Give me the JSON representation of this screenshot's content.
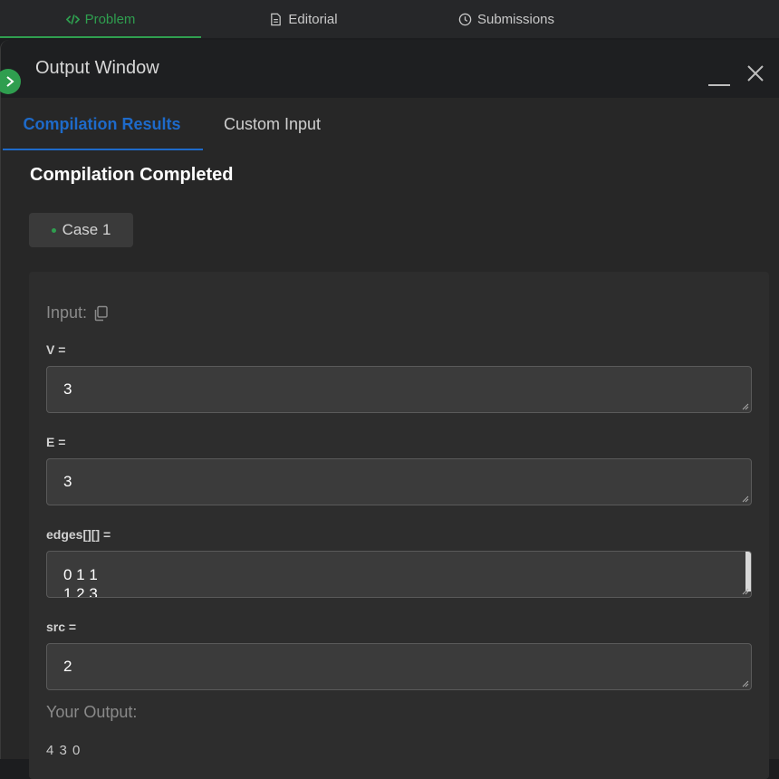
{
  "top_tabs": [
    {
      "label": "Problem",
      "icon": "code-icon",
      "active": true
    },
    {
      "label": "Editorial",
      "icon": "document-icon",
      "active": false
    },
    {
      "label": "Submissions",
      "icon": "clock-icon",
      "active": false
    }
  ],
  "panel": {
    "title": "Output Window"
  },
  "sub_tabs": [
    {
      "label": "Compilation Results",
      "active": true
    },
    {
      "label": "Custom Input",
      "active": false
    }
  ],
  "status_title": "Compilation Completed",
  "case_chip": "Case 1",
  "input": {
    "label": "Input:",
    "fields": [
      {
        "name": "V =",
        "value": "3"
      },
      {
        "name": "E =",
        "value": "3"
      },
      {
        "name": "edges[][] =",
        "value_lines": [
          "0 1 1",
          "1 2 3"
        ]
      },
      {
        "name": "src =",
        "value": "2"
      }
    ]
  },
  "output": {
    "label": "Your Output:",
    "value": "4 3 0"
  },
  "colors": {
    "accent_green": "#2f9e4f",
    "accent_blue": "#1e6ac9",
    "background": "#272727"
  }
}
